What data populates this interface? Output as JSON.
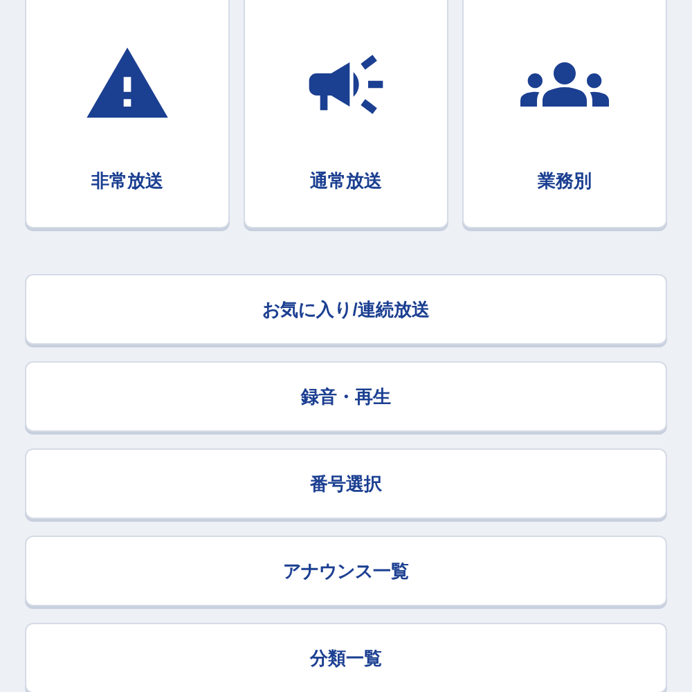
{
  "cards": [
    {
      "kind": "warning",
      "label": "非常放送"
    },
    {
      "kind": "megaphone",
      "label": "通常放送"
    },
    {
      "kind": "group",
      "label": "業務別"
    }
  ],
  "menu": [
    "お気に入り/連続放送",
    "録音・再生",
    "番号選択",
    "アナウンス一覧",
    "分類一覧"
  ]
}
